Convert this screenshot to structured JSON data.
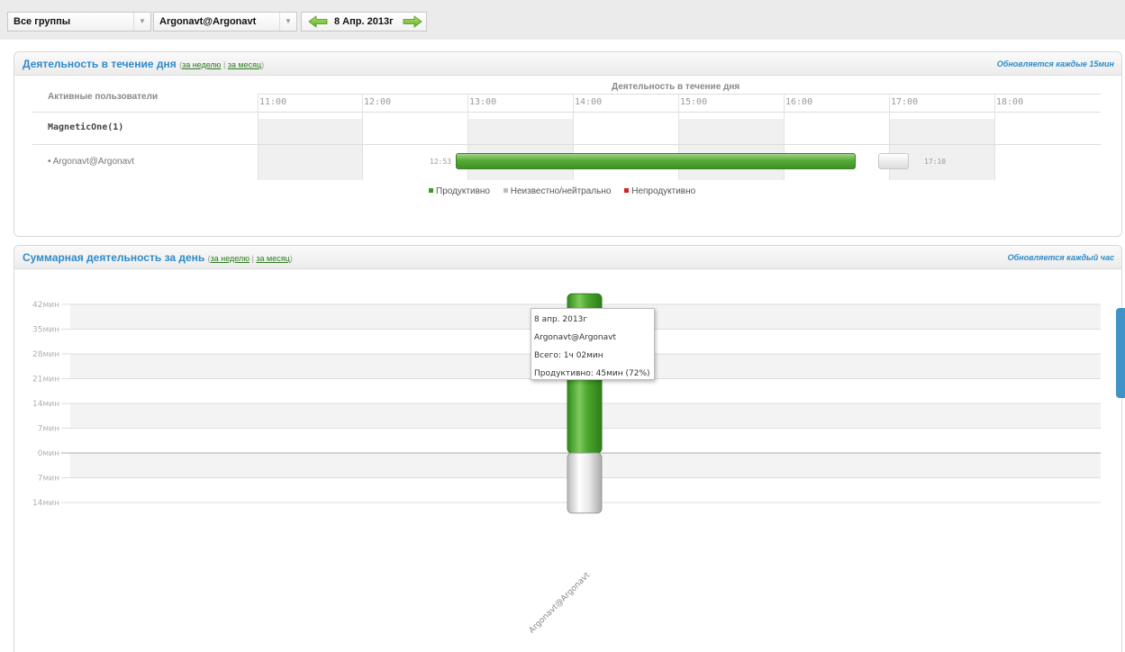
{
  "toolbar": {
    "groups_select": "Все группы",
    "user_select": "Argonavt@Argonavt",
    "date": "8 Апр. 2013г"
  },
  "colors": {
    "productive": "#3a9a22",
    "neutral": "#bcbcbc",
    "unproductive": "#d8202a",
    "title_blue": "#2f8bc9",
    "link_green": "#2d7b1e"
  },
  "daily_activity": {
    "title": "Деятельность в течение дня",
    "link_week": "за неделю",
    "separator": "|",
    "link_month": "за месяц",
    "update_note": "Обновляется каждые 15мин",
    "column_header": "Активные пользователи",
    "grid_title": "Деятельность в течение дня",
    "hours": [
      "11:00",
      "12:00",
      "13:00",
      "14:00",
      "15:00",
      "16:00",
      "17:00",
      "18:00"
    ],
    "group_name": "MagneticOne(1)",
    "user_name": "• Argonavt@Argonavt",
    "session_start": "12:53",
    "session_end": "17:10",
    "legend": {
      "productive": "Продуктивно",
      "neutral": "Неизвестно/нейтрально",
      "unproductive": "Непродуктивно"
    }
  },
  "summary": {
    "title": "Суммарная деятельность за день",
    "link_week": "за неделю",
    "separator": "|",
    "link_month": "за месяц",
    "update_note": "Обновляется каждый час",
    "tooltip": {
      "date": "8 апр. 2013г",
      "user": "Argonavt@Argonavt",
      "total": "Всего: 1ч 02мин",
      "productive": "Продуктивно: 45мин (72%)"
    }
  },
  "chart_data": {
    "type": "bar",
    "categories": [
      "Argonavt@Argonavt"
    ],
    "series": [
      {
        "name": "Продуктивно",
        "values": [
          45
        ],
        "color": "#3a9a22"
      },
      {
        "name": "Неизвестно/нейтрально",
        "values": [
          -17
        ],
        "color": "#cfcfcf"
      }
    ],
    "y_ticks": [
      {
        "value": 42,
        "label": "42мин"
      },
      {
        "value": 35,
        "label": "35мин"
      },
      {
        "value": 28,
        "label": "28мин"
      },
      {
        "value": 21,
        "label": "21мин"
      },
      {
        "value": 14,
        "label": "14мин"
      },
      {
        "value": 7,
        "label": "7мин"
      },
      {
        "value": 0,
        "label": "0мин"
      },
      {
        "value": -7,
        "label": "7мин"
      },
      {
        "value": -14,
        "label": "14мин"
      }
    ],
    "ylim": [
      -17,
      45
    ],
    "grid": true,
    "title": "",
    "xlabel": "",
    "ylabel": ""
  }
}
